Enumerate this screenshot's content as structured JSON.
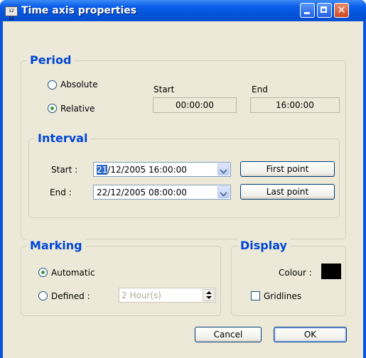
{
  "window": {
    "title": "Time axis properties",
    "icon_text": "12 12",
    "minimize_glyph": "",
    "close_glyph": "✕"
  },
  "period": {
    "legend": "Period",
    "absolute_label": "Absolute",
    "relative_label": "Relative",
    "selected": "Relative",
    "start_header": "Start",
    "end_header": "End",
    "start_value": "00:00:00",
    "end_value": "16:00:00"
  },
  "interval": {
    "legend": "Interval",
    "start_label": "Start :",
    "end_label": "End :",
    "start_value_selected": "21",
    "start_value_rest": "/12/2005 16:00:00",
    "end_value": "22/12/2005 08:00:00",
    "first_point_label": "First point",
    "last_point_label": "Last point"
  },
  "marking": {
    "legend": "Marking",
    "automatic_label": "Automatic",
    "defined_label": "Defined :",
    "selected": "Automatic",
    "defined_value": "2 Hour(s)"
  },
  "display": {
    "legend": "Display",
    "colour_label": "Colour :",
    "colour_value": "#000000",
    "gridlines_label": "Gridlines",
    "gridlines_checked": false
  },
  "footer": {
    "cancel_label": "Cancel",
    "ok_label": "OK"
  }
}
